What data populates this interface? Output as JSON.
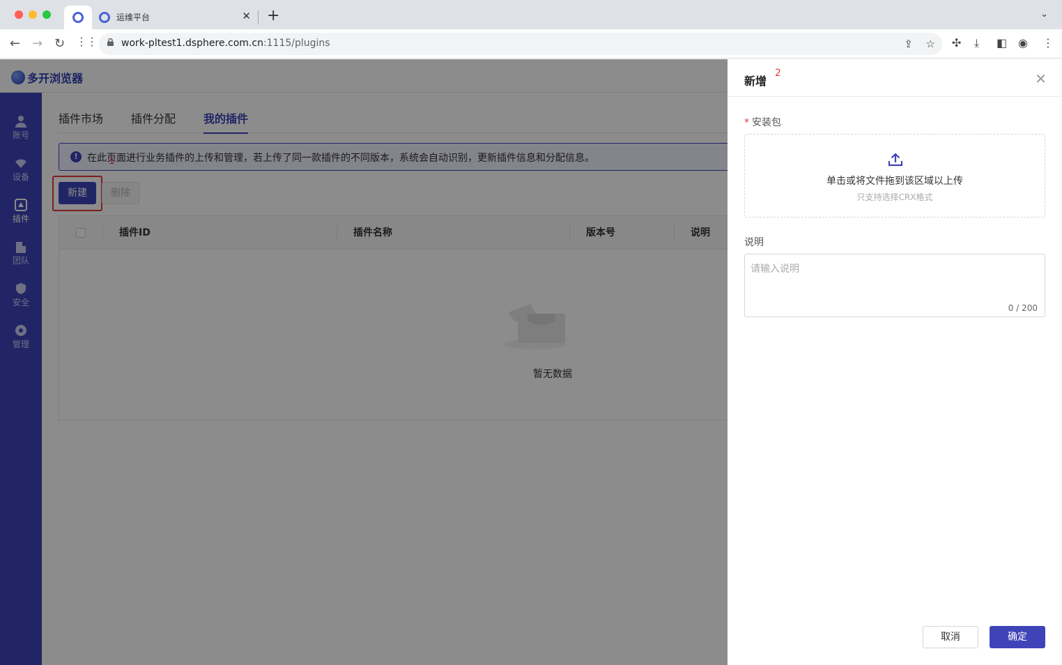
{
  "browser": {
    "tab_title": "运维平台",
    "url_host": "work-pltest1.dsphere.com.cn",
    "url_path": ":1115/plugins"
  },
  "app": {
    "logo_text": "多开浏览器",
    "sidebar": [
      {
        "label": "账号",
        "icon": "user-icon"
      },
      {
        "label": "设备",
        "icon": "wifi-icon"
      },
      {
        "label": "插件",
        "icon": "plugin-icon"
      },
      {
        "label": "团队",
        "icon": "building-icon"
      },
      {
        "label": "安全",
        "icon": "shield-icon"
      },
      {
        "label": "管理",
        "icon": "gear-icon"
      }
    ],
    "tabs": [
      "插件市场",
      "插件分配",
      "我的插件"
    ],
    "alert": "在此页面进行业务插件的上传和管理，若上传了同一款插件的不同版本，系统会自动识别，更新插件信息和分配信息。",
    "buttons": {
      "new": "新建",
      "delete": "删除"
    },
    "table": {
      "columns": [
        "插件ID",
        "插件名称",
        "版本号",
        "说明"
      ],
      "empty": "暂无数据"
    },
    "annotations": {
      "first": "1",
      "second": "2"
    }
  },
  "drawer": {
    "title": "新增",
    "package_label": "安装包",
    "upload_main": "单击或将文件拖到该区域以上传",
    "upload_sub": "只支持选择CRX格式",
    "desc_label": "说明",
    "desc_placeholder": "请输入说明",
    "desc_count": "0 / 200",
    "cancel": "取消",
    "confirm": "确定"
  },
  "colors": {
    "accent": "#3e44b8",
    "annotation": "#e53935"
  }
}
